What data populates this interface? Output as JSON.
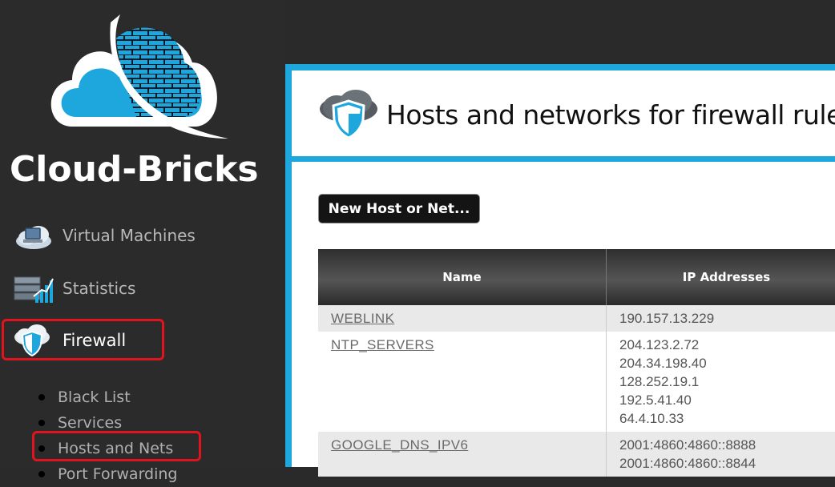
{
  "brand": {
    "name": "Cloud-Bricks",
    "accent_color": "#1ea7dc"
  },
  "sidebar": {
    "items": [
      {
        "label": "Virtual Machines",
        "icon": "cloud-computer-icon"
      },
      {
        "label": "Statistics",
        "icon": "server-chart-icon"
      },
      {
        "label": "Firewall",
        "icon": "cloud-shield-icon",
        "active": true
      }
    ],
    "subitems": [
      {
        "label": "Black List"
      },
      {
        "label": "Services"
      },
      {
        "label": "Hosts and Nets",
        "active": true
      },
      {
        "label": "Port Forwarding"
      }
    ]
  },
  "main": {
    "title": "Hosts and networks for firewall rules",
    "new_button_label": "New Host or Net...",
    "table": {
      "headers": [
        "Name",
        "IP Addresses"
      ],
      "rows": [
        {
          "name": "WEBLINK",
          "ips": [
            "190.157.13.229"
          ]
        },
        {
          "name": "NTP_SERVERS",
          "ips": [
            "204.123.2.72",
            "204.34.198.40",
            "128.252.19.1",
            "192.5.41.40",
            "64.4.10.33"
          ]
        },
        {
          "name": "GOOGLE_DNS_IPV6",
          "ips": [
            "2001:4860:4860::8888",
            "2001:4860:4860::8844"
          ]
        }
      ]
    }
  }
}
